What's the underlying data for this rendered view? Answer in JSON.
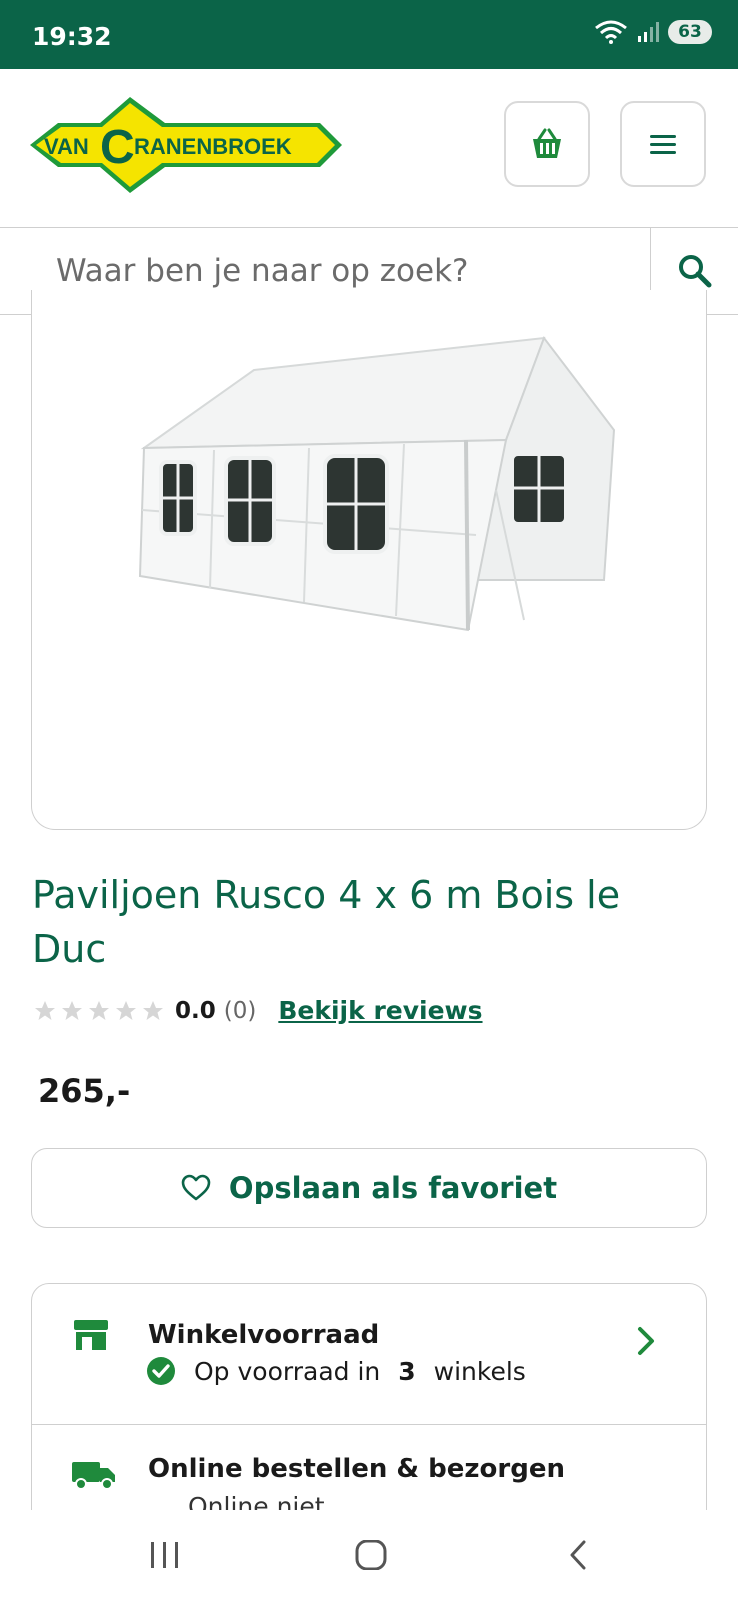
{
  "status_bar": {
    "time": "19:32",
    "battery": "63",
    "icons": [
      "wifi-icon",
      "signal-icon",
      "battery-icon"
    ]
  },
  "header": {
    "logo_text": "VANCRANENBROEK",
    "cart_icon": "basket-icon",
    "menu_icon": "hamburger-icon"
  },
  "search": {
    "placeholder": "Waar ben je naar op zoek?",
    "button_icon": "search-icon"
  },
  "product": {
    "title": "Paviljoen Rusco 4 x 6 m Bois le Duc",
    "rating_value": "0.0",
    "rating_count": "(0)",
    "rating_stars": 0,
    "reviews_link": "Bekijk reviews",
    "price": "265,-",
    "favorite_label": "Opslaan als favoriet"
  },
  "availability": {
    "store": {
      "title": "Winkelvoorraad",
      "status_prefix": "Op voorraad in",
      "count": "3",
      "status_suffix": "winkels"
    },
    "online": {
      "title": "Online bestellen & bezorgen",
      "status": "Online niet"
    }
  },
  "colors": {
    "brand_green": "#0b6448",
    "logo_yellow": "#f5e400",
    "logo_green": "#1f9a3a"
  }
}
